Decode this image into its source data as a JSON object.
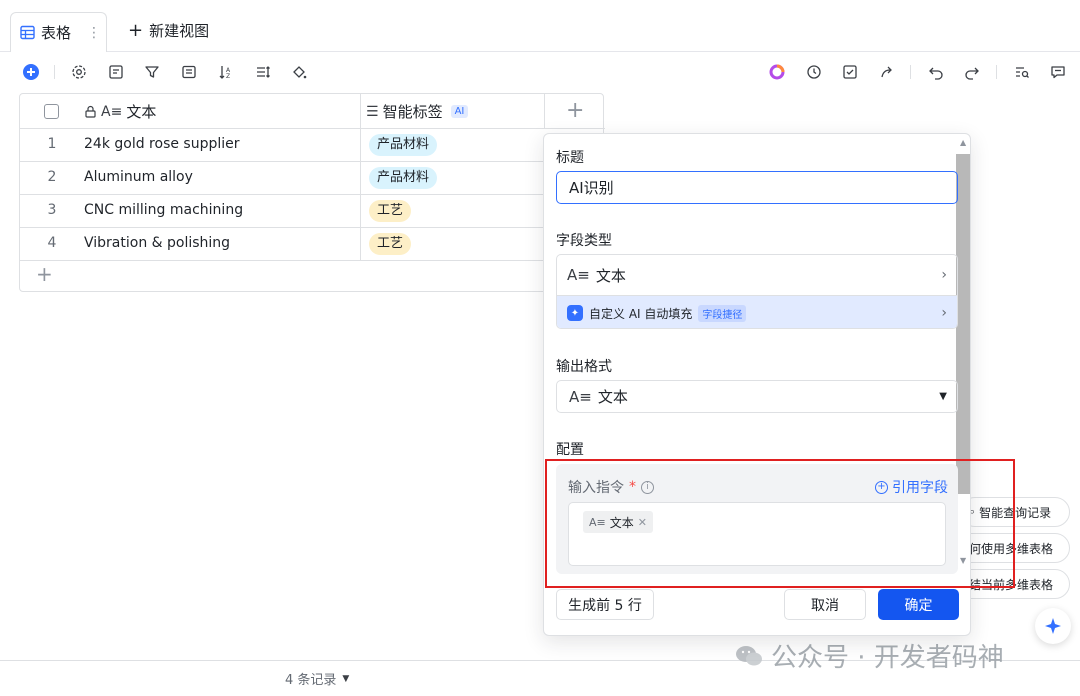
{
  "tabs": {
    "active_label": "表格",
    "new_view_label": "新建视图"
  },
  "grid": {
    "columns": [
      {
        "label": "文本",
        "type_icon": "text-type-icon"
      },
      {
        "label": "智能标签",
        "badge": "AI"
      }
    ],
    "rows": [
      {
        "num": "1",
        "text": "24k gold rose supplier",
        "tag": "产品材料"
      },
      {
        "num": "2",
        "text": "Aluminum alloy",
        "tag": "产品材料"
      },
      {
        "num": "3",
        "text": "CNC milling machining",
        "tag": "工艺"
      },
      {
        "num": "4",
        "text": "Vibration & polishing",
        "tag": "工艺"
      }
    ],
    "tag_colors": {
      "产品材料": "#d9f3fd",
      "工艺": "#fdefc7"
    }
  },
  "panel": {
    "title_label": "标题",
    "title_value": "AI识别",
    "field_type_label": "字段类型",
    "field_type_value": "文本",
    "ai_option_label": "自定义 AI 自动填充",
    "ai_option_tag": "字段捷径",
    "output_format_label": "输出格式",
    "output_format_value": "文本",
    "config_label": "配置",
    "instruction_label": "输入指令",
    "required_mark": "*",
    "cite_field_label": "引用字段",
    "chip_label": "文本",
    "generate_label": "生成前 5 行",
    "cancel_label": "取消",
    "ok_label": "确定"
  },
  "side_pills": {
    "p1": "智能查询记录",
    "p2": "如何使用多维表格",
    "p3": "总结当前多维表格"
  },
  "footer": {
    "record_count": "4 条记录"
  },
  "watermark": {
    "text": "公众号 · 开发者码神"
  },
  "colors": {
    "accent": "#3370ff",
    "primary_button": "#1456f0",
    "highlight_frame": "#e02020"
  }
}
